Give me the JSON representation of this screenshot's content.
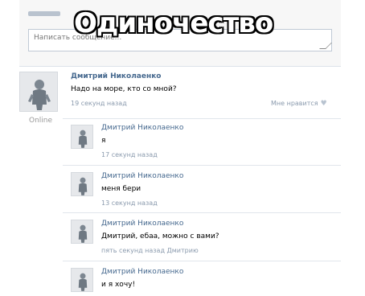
{
  "meme_title": "Одиночество",
  "composer": {
    "placeholder": "Написать сообщение..."
  },
  "post": {
    "author": "Дмитрий Николаенко",
    "text": "Надо на море, кто со мной?",
    "time": "19 секунд назад",
    "like_label": "Мне нравится",
    "status": "Online"
  },
  "replies": [
    {
      "author": "Дмитрий Николаенко",
      "text": "я",
      "time": "17 секунд назад"
    },
    {
      "author": "Дмитрий Николаенко",
      "text": "меня бери",
      "time": "13 секунд назад"
    },
    {
      "author": "Дмитрий Николаенко",
      "text": "Дмитрий, ебаа, можно с вами?",
      "time": "пять секунд назад Дмитрию"
    },
    {
      "author": "Дмитрий Николаенко",
      "text": "и я хочу!",
      "time": ""
    }
  ],
  "icons": {
    "like": "heart-icon",
    "avatar": "person-avatar-icon",
    "resize": "resize-grip-icon"
  },
  "colors": {
    "link": "#45688e",
    "meta": "#8a9aad",
    "background": "#ffffff"
  }
}
